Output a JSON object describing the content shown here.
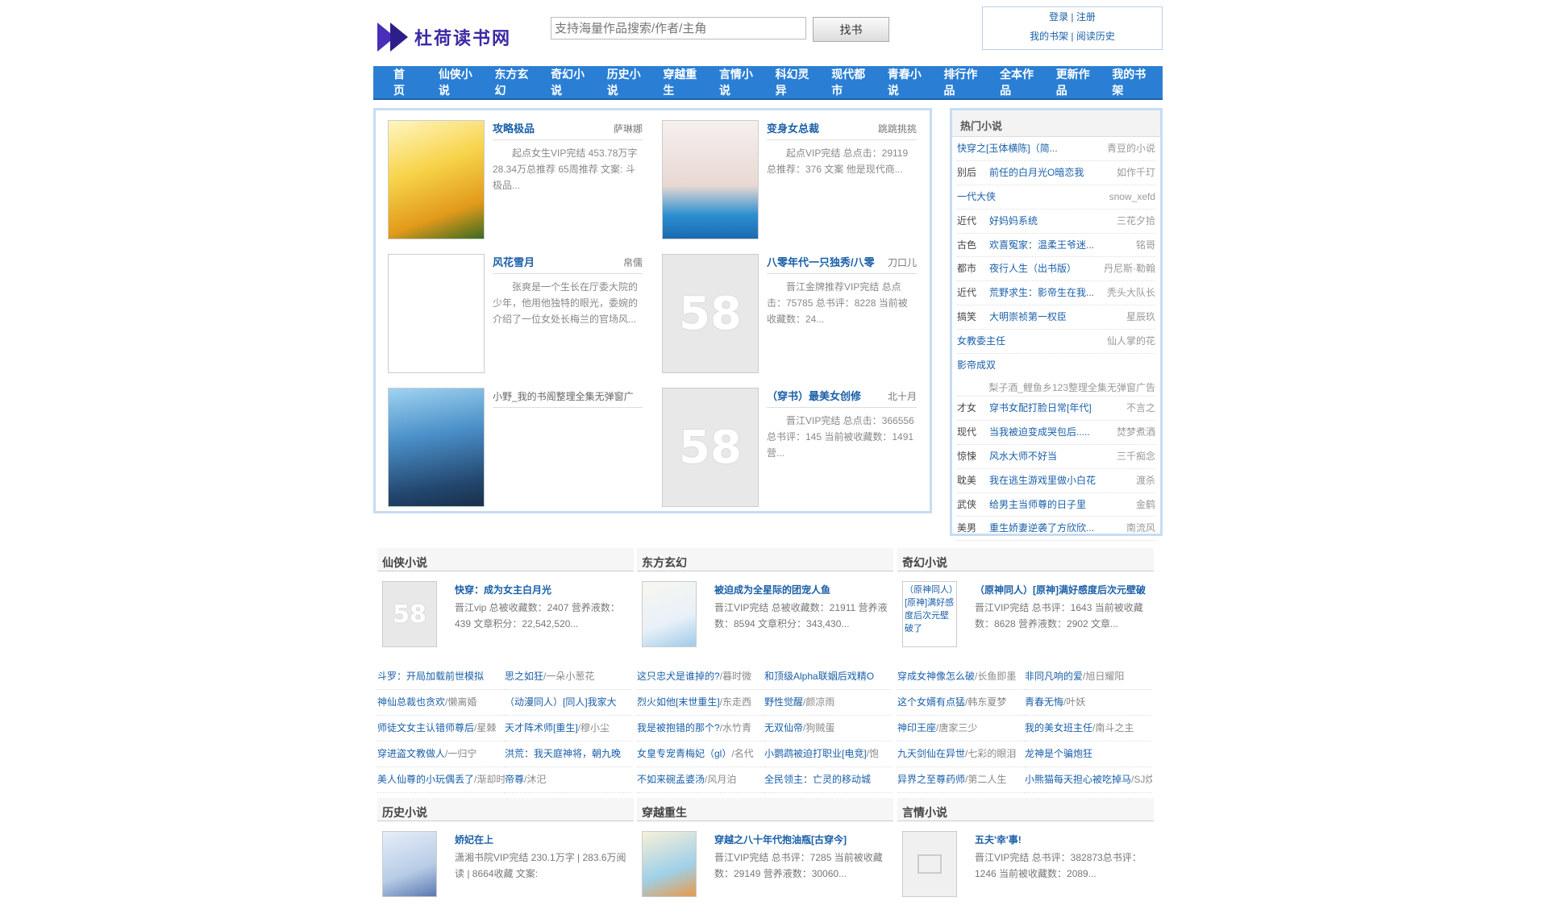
{
  "header": {
    "logo_text": "杜荷读书网",
    "search_placeholder": "支持海量作品搜索/作者/主角",
    "search_button": "找书",
    "login": "登录",
    "sep": " | ",
    "register": "注册",
    "bookshelf": "我的书架",
    "history": "阅读历史"
  },
  "nav": [
    "首页",
    "仙侠小说",
    "东方玄幻",
    "奇幻小说",
    "历史小说",
    "穿越重生",
    "言情小说",
    "科幻灵异",
    "现代都市",
    "青春小说",
    "排行作品",
    "全本作品",
    "更新作品",
    "我的书架"
  ],
  "featured": [
    {
      "title": "攻略极品",
      "author": "萨琳娜",
      "desc": "起点女生VIP完结 453.78万字 28.34万总推荐 65周推荐 文案: 斗极品..."
    },
    {
      "title": "变身女总裁",
      "author": "跳跳挑挑",
      "desc": "起点VIP完结 总点击：29119 总推荐：376 文案 他是现代商..."
    },
    {
      "title": "风花雪月",
      "author": "帛儒",
      "desc": "张爽是一个生长在厅委大院的少年，他用他独特的眼光，委婉的介绍了一位女处长梅兰的官场风..."
    },
    {
      "title": "八零年代一只独秀/八零",
      "author": "刀口儿",
      "desc": "晋江金牌推荐VIP完结 总点击：75785 总书评：8228 当前被收藏数：24..."
    },
    {
      "title": "小野_我的书阁整理全集无弹窗广",
      "author": "",
      "desc": ""
    },
    {
      "title": "（穿书）最美女创修",
      "author": "北十月",
      "desc": "晋江VIP完结 总点击：366556 总书评：145 当前被收藏数：1491 营..."
    }
  ],
  "hot": {
    "title": "热门小说",
    "items": [
      {
        "cat": "",
        "title": "快穿之[玉体横陈]（简...",
        "author": "青豆的小说"
      },
      {
        "cat": "别后",
        "title": "前任的白月光O暗恋我",
        "author": "如作千玎"
      },
      {
        "cat": "",
        "title": "一代大侠",
        "author": "snow_xefd"
      },
      {
        "cat": "近代",
        "title": "好妈妈系统",
        "author": "三花夕拾"
      },
      {
        "cat": "古色",
        "title": "欢喜冤家：温柔王爷迷...",
        "author": "铭哥"
      },
      {
        "cat": "都市",
        "title": "夜行人生（出书版）",
        "author": "丹尼斯·勒翰"
      },
      {
        "cat": "近代",
        "title": "荒野求生：影帝生在我...",
        "author": "秃头大队长"
      },
      {
        "cat": "搞笑",
        "title": "大明崇祯第一权臣",
        "author": "星辰玖"
      },
      {
        "cat": "",
        "title": "女教委主任",
        "author": "仙人掌的花"
      },
      {
        "cat": "",
        "title": "影帝成双",
        "author": "梨子酒_鲤鱼乡123整理全集无弹窗广告",
        "two": true
      },
      {
        "cat": "才女",
        "title": "穿书女配打脸日常[年代]",
        "author": "不言之"
      },
      {
        "cat": "现代",
        "title": "当我被迫变成哭包后.....",
        "author": "焚梦煮酒"
      },
      {
        "cat": "惊悚",
        "title": "风水大师不好当",
        "author": "三千痴念"
      },
      {
        "cat": "耽美",
        "title": "我在逃生游戏里做小白花",
        "author": "渡杀"
      },
      {
        "cat": "武侠",
        "title": "给男主当师尊的日子里",
        "author": "金鹤"
      },
      {
        "cat": "美男",
        "title": "重生娇妻逆袭了方欣欣...",
        "author": "南流风"
      }
    ]
  },
  "blocks": [
    {
      "name": "仙侠小说",
      "top_title": "快穿：成为女主白月光",
      "top_desc": "晋江vip 总被收藏数：2407 营养液数：439 文章积分：22,542,520...",
      "list": [
        [
          "斗罗：开局加载前世模拟",
          ""
        ],
        [
          "思之如狂",
          "/一朵小葱花"
        ],
        [
          "神仙总裁也贪欢",
          "/懒离婚"
        ],
        [
          "（动漫同人）[同人]我家大",
          ""
        ],
        [
          "师徒文女主认错师尊后",
          "/星棘"
        ],
        [
          "天才阵术师[重生]",
          "/穆小尘"
        ],
        [
          "穿进盗文教做人",
          "/一归宁"
        ],
        [
          "洪荒：我天庭神将，朝九晚",
          ""
        ],
        [
          "美人仙尊的小玩偶丢了",
          "/渐却时光"
        ],
        [
          "帝尊",
          "/沐汜"
        ]
      ]
    },
    {
      "name": "东方玄幻",
      "top_title": "被迫成为全星际的团宠人鱼",
      "top_desc": "晋江VIP完结 总被收藏数：21911 营养液数：8594 文章积分：343,430...",
      "list": [
        [
          "这只忠犬是谁掉的?",
          "/暮时微"
        ],
        [
          "和顶级Alpha联姻后戏精O",
          ""
        ],
        [
          "烈火如他[末世重生]",
          "/东走西"
        ],
        [
          "野性觉醒",
          "/颜凉雨"
        ],
        [
          "我是被抱错的那个?",
          "/水竹青"
        ],
        [
          "无双仙帝",
          "/狗贼蛋"
        ],
        [
          "女皇专宠青梅妃（gl）",
          "/名代"
        ],
        [
          "小鹦鹉被迫打职业[电竞]",
          "/饱"
        ],
        [
          "不如来碗孟婆汤",
          "/风月泊"
        ],
        [
          "全民领主：亡灵的移动城",
          ""
        ]
      ]
    },
    {
      "name": "奇幻小说",
      "top_title": "（原神同人）[原神]满好感度后次元壁破",
      "top_desc": "晋江VIP完结 总书评：1643 当前被收藏数：8628 营养液数：2902 文章...",
      "cover_alt": "（原神同人）[原神]满好感度后次元壁破了",
      "list": [
        [
          "穿成女神像怎么破",
          "/长鱼即墨"
        ],
        [
          "非同凡响的爱",
          "/旭日耀阳"
        ],
        [
          "这个女婿有点猛",
          "/韩东夏梦"
        ],
        [
          "青春无悔",
          "/叶妖"
        ],
        [
          "神印王座",
          "/唐家三少"
        ],
        [
          "我的美女班主任",
          "/南斗之主"
        ],
        [
          "九天剑仙在异世",
          "/七彩的眼泪"
        ],
        [
          "龙神是个骗炮狂",
          ""
        ],
        [
          "异界之至尊药师",
          "/第二人生"
        ],
        [
          "小熊猫每天担心被吃掉马",
          "/SJ炆"
        ]
      ]
    },
    {
      "name": "历史小说",
      "top_title": "娇妃在上",
      "top_desc": "潇湘书院VIP完结 230.1万字 | 283.6万阅读 | 8664收藏 文案:",
      "list": []
    },
    {
      "name": "穿越重生",
      "top_title": "穿越之八十年代抱油瓶[古穿今]",
      "top_desc": "晋江VIP完结 总书评：7285 当前被收藏数：29149 营养液数：30060...",
      "list": []
    },
    {
      "name": "言情小说",
      "top_title": "五夫'幸'事!",
      "top_desc": "晋江VIP完结 总书评：382873总书评：1246 当前被收藏数：2089...",
      "list": []
    }
  ],
  "colors": {
    "nav_bg": "#2a7fd4",
    "link": "#1a5fa8",
    "box_border": "#c7dcf0"
  }
}
